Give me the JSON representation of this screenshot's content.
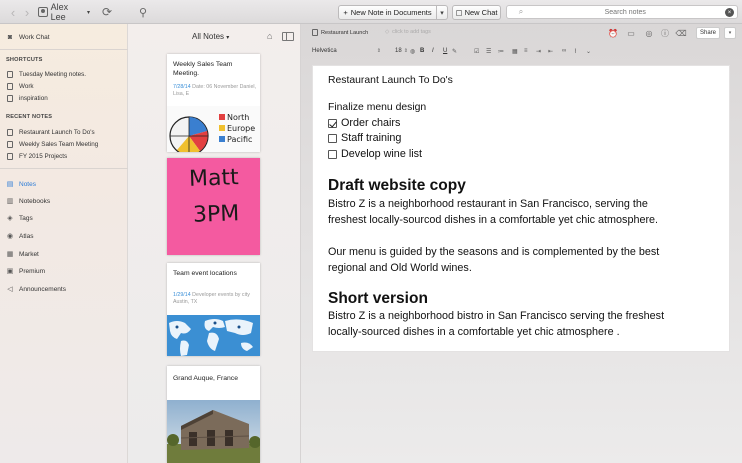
{
  "colors": {
    "accent": "#2b7bd6",
    "sticky_pink": "#f45aa0",
    "map_blue": "#3b8fd3"
  },
  "titlebar": {
    "account_name": "Alex Lee",
    "new_note_label": "New Note in Documents",
    "new_chat_label": "New Chat",
    "search_placeholder": "Search notes"
  },
  "sidebar": {
    "work_chat": "Work Chat",
    "shortcuts_header": "SHORTCUTS",
    "shortcuts": [
      "Tuesday Meeting notes.",
      "Work",
      "inspiration"
    ],
    "recent_header": "RECENT NOTES",
    "recent": [
      "Restaurant Launch To Do's",
      "Weekly Sales Team Meeting",
      "FY 2015 Projects"
    ],
    "nav": [
      "Notes",
      "Notebooks",
      "Tags",
      "Atlas",
      "Market",
      "Premium",
      "Announcements"
    ]
  },
  "notelist": {
    "title": "All Notes",
    "cards": [
      {
        "title": "Weekly Sales Team Meeting.",
        "date": "7/28/14",
        "snippet": "Date: 06 November Daniel, Lisa, E"
      },
      {
        "title": "",
        "sticky_text": [
          "Matt",
          "3PM"
        ]
      },
      {
        "title": "Team event locations",
        "date": "1/29/14",
        "snippet": "Developer events by city Austin, TX"
      },
      {
        "title": "Grand Auque, France"
      }
    ],
    "chart_words": [
      "North",
      "Europe",
      "Pacific"
    ]
  },
  "editor": {
    "notebook": "Restaurant Launch",
    "tag_placeholder": "click to add tags",
    "share_label": "Share",
    "font": "Helvetica",
    "font_size": "18",
    "format": {
      "bold": "B",
      "italic": "I",
      "underline": "U"
    },
    "note_title": "Restaurant Launch To Do's",
    "subheading": "Finalize menu design",
    "checklist": [
      {
        "label": "Order chairs",
        "checked": true
      },
      {
        "label": "Staff training",
        "checked": false
      },
      {
        "label": "Develop wine list",
        "checked": false
      }
    ],
    "section1_heading": "Draft website copy",
    "section1_lines": [
      "Bistro Z is a neighborhood restaurant in San Francisco, serving the",
      "freshest locally-sourcod dishes in a comfortable yet chic atmosphere."
    ],
    "section1b_lines": [
      "Our menu is guided by the seasons and is complemented by the best",
      "regional and Old World wines."
    ],
    "section2_heading": "Short version",
    "section2_lines": [
      "Bistro Z is a neighborhood bistro in San Francisco serving the freshest",
      "locally-sourced dishes in a comfortable yet chic atmosphere ."
    ]
  }
}
